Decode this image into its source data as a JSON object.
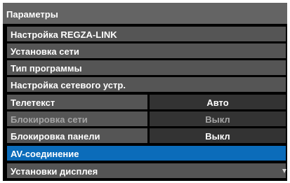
{
  "menu": {
    "title": "Параметры",
    "items": [
      {
        "label": "Настройка REGZA-LINK"
      },
      {
        "label": "Установка сети"
      },
      {
        "label": "Тип программы"
      },
      {
        "label": "Настройка сетевого устр."
      }
    ],
    "settings": [
      {
        "label": "Телетекст",
        "value": "Авто",
        "state": "enabled"
      },
      {
        "label": "Блокировка сети",
        "value": "Выкл",
        "state": "disabled"
      },
      {
        "label": "Блокировка панели",
        "value": "Выкл",
        "state": "enabled"
      }
    ],
    "selected_item": {
      "label": "AV-соединение"
    },
    "last_item": {
      "label": "Установки дисплея"
    },
    "scroll_icon": "scroll-down-icon"
  },
  "colors": {
    "background": "#000000",
    "title_bar": "#646464",
    "item": "#555555",
    "value_cell": "#333333",
    "selected": "#0b6cba",
    "text": "#ffffff",
    "text_disabled": "#a6a6a6"
  }
}
